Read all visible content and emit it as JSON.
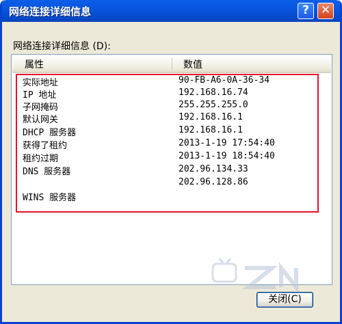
{
  "window": {
    "title": "网络连接详细信息"
  },
  "buttons": {
    "help_label": "?",
    "close_label": "✕",
    "close_dialog_label": "关闭(C)"
  },
  "list": {
    "label": "网络连接详细信息 (D):",
    "columns": [
      "属性",
      "数值"
    ],
    "rows": [
      {
        "property": "实际地址",
        "value": "90-FB-A6-0A-36-34"
      },
      {
        "property": "IP 地址",
        "value": "192.168.16.74"
      },
      {
        "property": "子网掩码",
        "value": "255.255.255.0"
      },
      {
        "property": "默认网关",
        "value": "192.168.16.1"
      },
      {
        "property": "DHCP 服务器",
        "value": "192.168.16.1"
      },
      {
        "property": "获得了租约",
        "value": "2013-1-19 17:54:40"
      },
      {
        "property": "租约过期",
        "value": "2013-1-19 18:54:40"
      },
      {
        "property": "DNS 服务器",
        "value": "202.96.134.33"
      },
      {
        "property": "",
        "value": "202.96.128.86"
      },
      {
        "property": "WINS 服务器",
        "value": ""
      }
    ]
  },
  "colors": {
    "titlebar": "#0855dd",
    "highlight": "#e8102e"
  }
}
